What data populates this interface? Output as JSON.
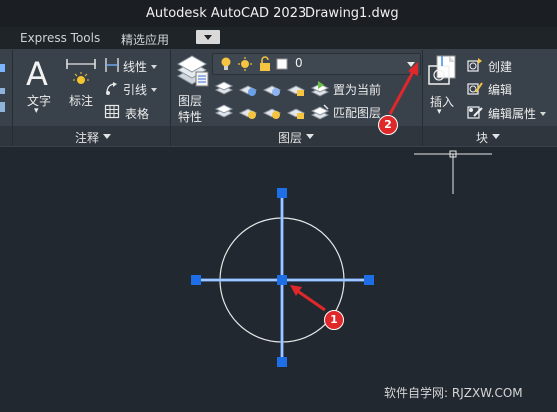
{
  "title": {
    "app": "Autodesk AutoCAD 2023",
    "document": "Drawing1.dwg"
  },
  "tabs": [
    {
      "label": "Express Tools"
    },
    {
      "label": "精选应用"
    }
  ],
  "annotation_panel": {
    "title": "注释",
    "text_label": "文字",
    "dimension_label": "标注",
    "linear_label": "线性",
    "leader_label": "引线",
    "table_label": "表格"
  },
  "layers_panel": {
    "title": "图层",
    "layer_properties_label": "图层\n特性",
    "layer_properties_line1": "图层",
    "layer_properties_line2": "特性",
    "current_layer": "0",
    "make_current_label": "置为当前",
    "match_layer_label": "匹配图层"
  },
  "block_panel": {
    "title": "块",
    "insert_label": "插入",
    "create_label": "创建",
    "edit_label": "编辑",
    "edit_attributes_label": "编辑属性"
  },
  "callouts": [
    {
      "number": "1"
    },
    {
      "number": "2"
    }
  ],
  "watermark": "软件自学网: RJZXW.COM",
  "colors": {
    "ribbon": "#39414a",
    "canvas": "#212830",
    "grip": "#1e6ee8",
    "selection": "#5aa0ff",
    "callout": "#e0282a"
  }
}
